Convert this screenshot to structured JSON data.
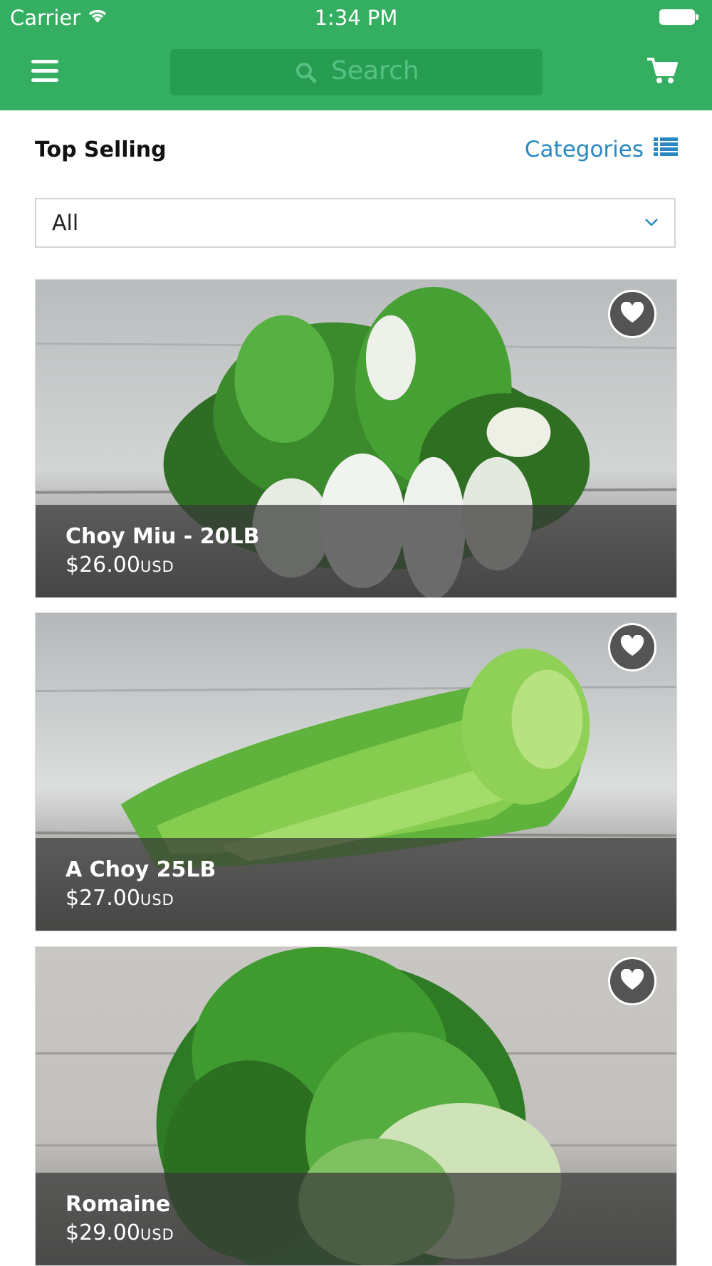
{
  "status_bar": {
    "carrier": "Carrier",
    "time": "1:34 PM"
  },
  "header": {
    "search_placeholder": "Search"
  },
  "section": {
    "title": "Top Selling",
    "categories_label": "Categories"
  },
  "filter": {
    "selected": "All"
  },
  "products": [
    {
      "name": "Choy Miu - 20LB",
      "price": "$26.00",
      "currency": "USD"
    },
    {
      "name": "A Choy 25LB",
      "price": "$27.00",
      "currency": "USD"
    },
    {
      "name": "Romaine",
      "price": "$29.00",
      "currency": "USD"
    }
  ],
  "colors": {
    "brand_green": "#34ae60",
    "link_blue": "#2a89c0"
  },
  "icons": [
    "wifi-icon",
    "battery-icon",
    "menu-icon",
    "search-icon",
    "cart-icon",
    "list-icon",
    "chevron-down-icon",
    "heart-icon"
  ]
}
